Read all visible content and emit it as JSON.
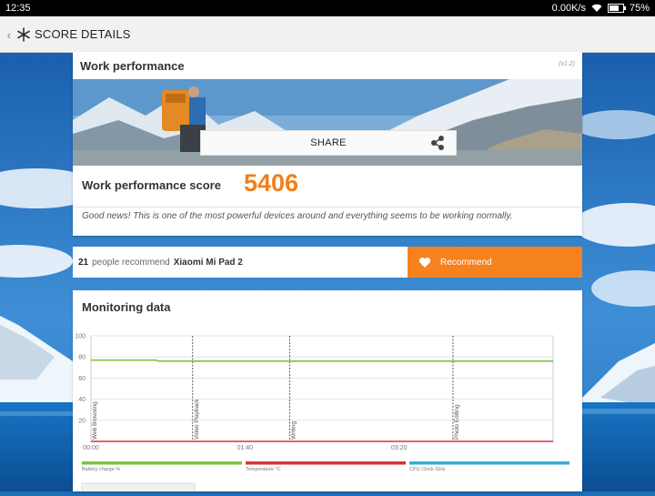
{
  "status_bar": {
    "time": "12:35",
    "network_speed": "0.00K/s",
    "battery": "75%",
    "battery_level": 0.75
  },
  "title_bar": {
    "title": "SCORE DETAILS"
  },
  "work_card": {
    "heading": "Work performance",
    "version": "(v1.2)",
    "share_label": "SHARE",
    "score_label": "Work performance score",
    "score_value": "5406",
    "message": "Good news! This is one of the most powerful devices around and everything seems to be working normally."
  },
  "recommend": {
    "count": "21",
    "text": "people recommend",
    "device": "Xiaomi Mi Pad 2",
    "button_label": "Recommend"
  },
  "monitoring": {
    "heading": "Monitoring data"
  },
  "chart_data": {
    "type": "line",
    "ylim": [
      0,
      100
    ],
    "yticks": [
      "100",
      "80",
      "60",
      "40",
      "20"
    ],
    "xticks": [
      "00:00",
      "01:40",
      "03:20"
    ],
    "x_range_seconds": [
      0,
      300
    ],
    "segment_labels": [
      {
        "label": "Web Browsing",
        "x": 0
      },
      {
        "label": "Video Playback",
        "x": 66
      },
      {
        "label": "Writing",
        "x": 129
      },
      {
        "label": "Photo Editing",
        "x": 235
      }
    ],
    "series": [
      {
        "name": "Battery charge %",
        "color": "#7cc142",
        "x": [
          0,
          42,
          44,
          300
        ],
        "values": [
          77,
          77,
          76,
          76
        ]
      },
      {
        "name": "Temperature °C",
        "color": "#d9323a",
        "x": [
          0,
          300
        ],
        "values": [
          0,
          0
        ]
      },
      {
        "name": "CPU Clock GHz",
        "color": "#3aabd9",
        "x": [],
        "values": []
      }
    ]
  },
  "colors": {
    "accent": "#f5821f",
    "score": "#f0801a"
  }
}
